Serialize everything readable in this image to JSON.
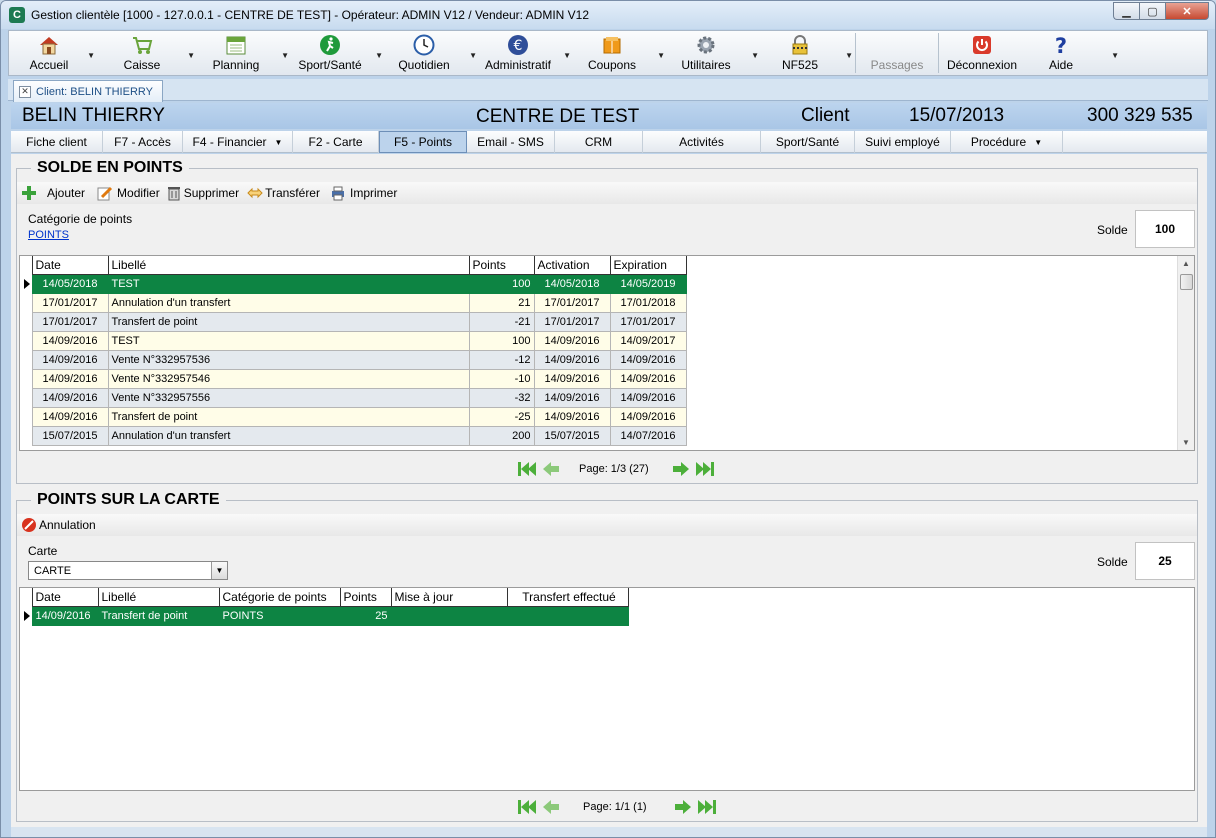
{
  "window": {
    "title": "Gestion clientèle [1000 - 127.0.0.1 - CENTRE DE TEST] - Opérateur: ADMIN V12 / Vendeur: ADMIN V12"
  },
  "toolbar": [
    {
      "label": "Accueil",
      "icon": "home-icon",
      "dropdown": true
    },
    {
      "label": "Caisse",
      "icon": "cart-icon",
      "dropdown": true
    },
    {
      "label": "Planning",
      "icon": "calendar-icon",
      "dropdown": true
    },
    {
      "label": "Sport/Santé",
      "icon": "runner-icon",
      "dropdown": true
    },
    {
      "label": "Quotidien",
      "icon": "clock-icon",
      "dropdown": true
    },
    {
      "label": "Administratif",
      "icon": "euro-icon",
      "dropdown": true
    },
    {
      "label": "Coupons",
      "icon": "coupon-icon",
      "dropdown": true
    },
    {
      "label": "Utilitaires",
      "icon": "gear-icon",
      "dropdown": true
    },
    {
      "label": "NF525",
      "icon": "lock-icon",
      "dropdown": true
    },
    {
      "label": "Passages",
      "icon": "",
      "dropdown": false,
      "disabled": true
    },
    {
      "label": "Déconnexion",
      "icon": "power-icon",
      "dropdown": false
    },
    {
      "label": "Aide",
      "icon": "help-icon",
      "dropdown": true
    }
  ],
  "client_tab": {
    "label": "Client: BELIN THIERRY"
  },
  "header": {
    "name": "BELIN THIERRY",
    "center": "CENTRE DE TEST",
    "type": "Client",
    "date": "15/07/2013",
    "phone": "300 329 535"
  },
  "subtabs": [
    {
      "label": "Fiche client"
    },
    {
      "label": "F7 - Accès"
    },
    {
      "label": "F4 - Financier",
      "dropdown": true
    },
    {
      "label": "F2 - Carte"
    },
    {
      "label": "F5 - Points",
      "active": true
    },
    {
      "label": "Email - SMS"
    },
    {
      "label": "CRM"
    },
    {
      "label": "Activités"
    },
    {
      "label": "Sport/Santé"
    },
    {
      "label": "Suivi employé"
    },
    {
      "label": "Procédure",
      "dropdown": true
    }
  ],
  "solde_points": {
    "title": "SOLDE EN POINTS",
    "actions": {
      "ajouter": "Ajouter",
      "modifier": "Modifier",
      "supprimer": "Supprimer",
      "transferer": "Transférer",
      "imprimer": "Imprimer"
    },
    "category_label": "Catégorie de points",
    "category_value": "POINTS",
    "solde_label": "Solde",
    "solde_value": "100",
    "columns": [
      "Date",
      "Libellé",
      "Points",
      "Activation",
      "Expiration"
    ],
    "rows": [
      [
        "14/05/2018",
        "TEST",
        "100",
        "14/05/2018",
        "14/05/2019"
      ],
      [
        "17/01/2017",
        "Annulation d'un transfert",
        "21",
        "17/01/2017",
        "17/01/2018"
      ],
      [
        "17/01/2017",
        "Transfert de point",
        "-21",
        "17/01/2017",
        "17/01/2017"
      ],
      [
        "14/09/2016",
        "TEST",
        "100",
        "14/09/2016",
        "14/09/2017"
      ],
      [
        "14/09/2016",
        "Vente N°332957536",
        "-12",
        "14/09/2016",
        "14/09/2016"
      ],
      [
        "14/09/2016",
        "Vente N°332957546",
        "-10",
        "14/09/2016",
        "14/09/2016"
      ],
      [
        "14/09/2016",
        "Vente N°332957556",
        "-32",
        "14/09/2016",
        "14/09/2016"
      ],
      [
        "14/09/2016",
        "Transfert de point",
        "-25",
        "14/09/2016",
        "14/09/2016"
      ],
      [
        "15/07/2015",
        "Annulation d'un transfert",
        "200",
        "15/07/2015",
        "14/07/2016"
      ]
    ],
    "pager": "Page: 1/3 (27)"
  },
  "points_carte": {
    "title": "POINTS SUR LA CARTE",
    "actions": {
      "annulation": "Annulation"
    },
    "carte_label": "Carte",
    "carte_value": "CARTE",
    "solde_label": "Solde",
    "solde_value": "25",
    "columns": [
      "Date",
      "Libellé",
      "Catégorie de points",
      "Points",
      "Mise à jour",
      "Transfert effectué"
    ],
    "rows": [
      [
        "14/09/2016",
        "Transfert de point",
        "POINTS",
        "25",
        "",
        ""
      ]
    ],
    "pager": "Page: 1/1 (1)"
  },
  "colors": {
    "selected_row": "#0d8443",
    "header_band": "#b3cde9",
    "row_even": "#fffde8",
    "row_odd": "#e4e9ee"
  }
}
